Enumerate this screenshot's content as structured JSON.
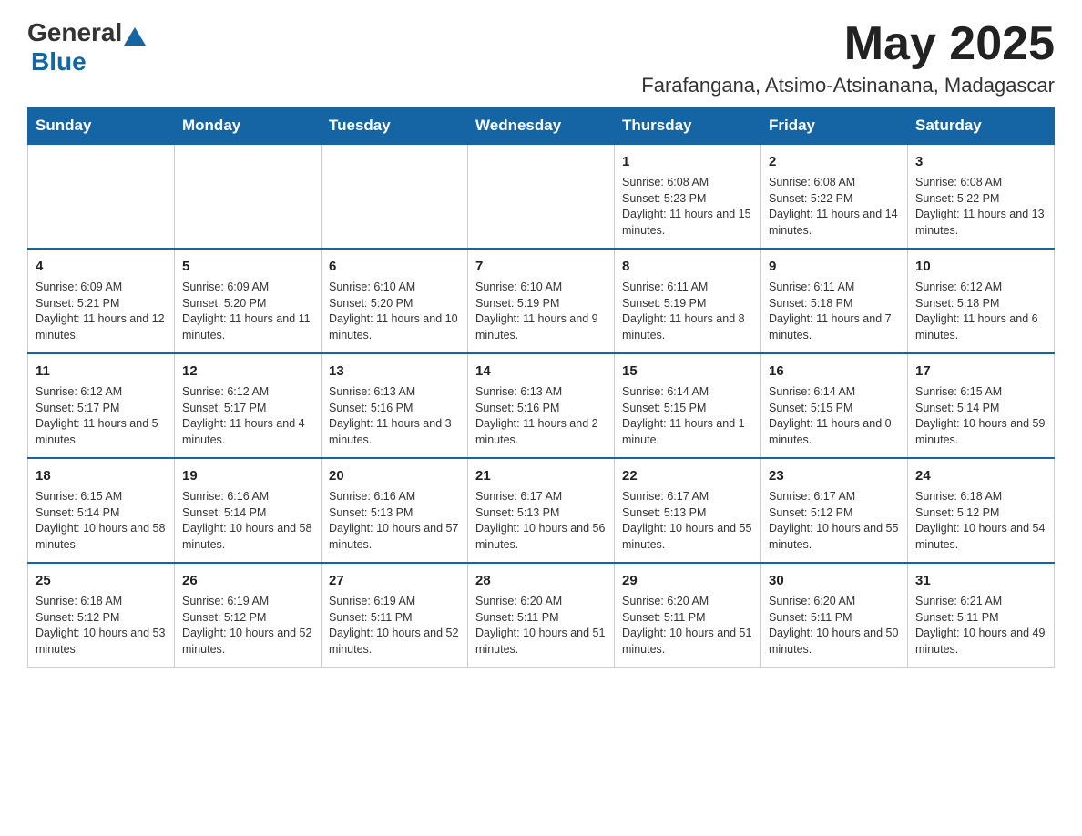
{
  "header": {
    "logo_general": "General",
    "logo_blue": "Blue",
    "month_year": "May 2025",
    "location": "Farafangana, Atsimo-Atsinanana, Madagascar"
  },
  "weekdays": [
    "Sunday",
    "Monday",
    "Tuesday",
    "Wednesday",
    "Thursday",
    "Friday",
    "Saturday"
  ],
  "weeks": [
    [
      {
        "day": "",
        "info": ""
      },
      {
        "day": "",
        "info": ""
      },
      {
        "day": "",
        "info": ""
      },
      {
        "day": "",
        "info": ""
      },
      {
        "day": "1",
        "info": "Sunrise: 6:08 AM\nSunset: 5:23 PM\nDaylight: 11 hours and 15 minutes."
      },
      {
        "day": "2",
        "info": "Sunrise: 6:08 AM\nSunset: 5:22 PM\nDaylight: 11 hours and 14 minutes."
      },
      {
        "day": "3",
        "info": "Sunrise: 6:08 AM\nSunset: 5:22 PM\nDaylight: 11 hours and 13 minutes."
      }
    ],
    [
      {
        "day": "4",
        "info": "Sunrise: 6:09 AM\nSunset: 5:21 PM\nDaylight: 11 hours and 12 minutes."
      },
      {
        "day": "5",
        "info": "Sunrise: 6:09 AM\nSunset: 5:20 PM\nDaylight: 11 hours and 11 minutes."
      },
      {
        "day": "6",
        "info": "Sunrise: 6:10 AM\nSunset: 5:20 PM\nDaylight: 11 hours and 10 minutes."
      },
      {
        "day": "7",
        "info": "Sunrise: 6:10 AM\nSunset: 5:19 PM\nDaylight: 11 hours and 9 minutes."
      },
      {
        "day": "8",
        "info": "Sunrise: 6:11 AM\nSunset: 5:19 PM\nDaylight: 11 hours and 8 minutes."
      },
      {
        "day": "9",
        "info": "Sunrise: 6:11 AM\nSunset: 5:18 PM\nDaylight: 11 hours and 7 minutes."
      },
      {
        "day": "10",
        "info": "Sunrise: 6:12 AM\nSunset: 5:18 PM\nDaylight: 11 hours and 6 minutes."
      }
    ],
    [
      {
        "day": "11",
        "info": "Sunrise: 6:12 AM\nSunset: 5:17 PM\nDaylight: 11 hours and 5 minutes."
      },
      {
        "day": "12",
        "info": "Sunrise: 6:12 AM\nSunset: 5:17 PM\nDaylight: 11 hours and 4 minutes."
      },
      {
        "day": "13",
        "info": "Sunrise: 6:13 AM\nSunset: 5:16 PM\nDaylight: 11 hours and 3 minutes."
      },
      {
        "day": "14",
        "info": "Sunrise: 6:13 AM\nSunset: 5:16 PM\nDaylight: 11 hours and 2 minutes."
      },
      {
        "day": "15",
        "info": "Sunrise: 6:14 AM\nSunset: 5:15 PM\nDaylight: 11 hours and 1 minute."
      },
      {
        "day": "16",
        "info": "Sunrise: 6:14 AM\nSunset: 5:15 PM\nDaylight: 11 hours and 0 minutes."
      },
      {
        "day": "17",
        "info": "Sunrise: 6:15 AM\nSunset: 5:14 PM\nDaylight: 10 hours and 59 minutes."
      }
    ],
    [
      {
        "day": "18",
        "info": "Sunrise: 6:15 AM\nSunset: 5:14 PM\nDaylight: 10 hours and 58 minutes."
      },
      {
        "day": "19",
        "info": "Sunrise: 6:16 AM\nSunset: 5:14 PM\nDaylight: 10 hours and 58 minutes."
      },
      {
        "day": "20",
        "info": "Sunrise: 6:16 AM\nSunset: 5:13 PM\nDaylight: 10 hours and 57 minutes."
      },
      {
        "day": "21",
        "info": "Sunrise: 6:17 AM\nSunset: 5:13 PM\nDaylight: 10 hours and 56 minutes."
      },
      {
        "day": "22",
        "info": "Sunrise: 6:17 AM\nSunset: 5:13 PM\nDaylight: 10 hours and 55 minutes."
      },
      {
        "day": "23",
        "info": "Sunrise: 6:17 AM\nSunset: 5:12 PM\nDaylight: 10 hours and 55 minutes."
      },
      {
        "day": "24",
        "info": "Sunrise: 6:18 AM\nSunset: 5:12 PM\nDaylight: 10 hours and 54 minutes."
      }
    ],
    [
      {
        "day": "25",
        "info": "Sunrise: 6:18 AM\nSunset: 5:12 PM\nDaylight: 10 hours and 53 minutes."
      },
      {
        "day": "26",
        "info": "Sunrise: 6:19 AM\nSunset: 5:12 PM\nDaylight: 10 hours and 52 minutes."
      },
      {
        "day": "27",
        "info": "Sunrise: 6:19 AM\nSunset: 5:11 PM\nDaylight: 10 hours and 52 minutes."
      },
      {
        "day": "28",
        "info": "Sunrise: 6:20 AM\nSunset: 5:11 PM\nDaylight: 10 hours and 51 minutes."
      },
      {
        "day": "29",
        "info": "Sunrise: 6:20 AM\nSunset: 5:11 PM\nDaylight: 10 hours and 51 minutes."
      },
      {
        "day": "30",
        "info": "Sunrise: 6:20 AM\nSunset: 5:11 PM\nDaylight: 10 hours and 50 minutes."
      },
      {
        "day": "31",
        "info": "Sunrise: 6:21 AM\nSunset: 5:11 PM\nDaylight: 10 hours and 49 minutes."
      }
    ]
  ]
}
